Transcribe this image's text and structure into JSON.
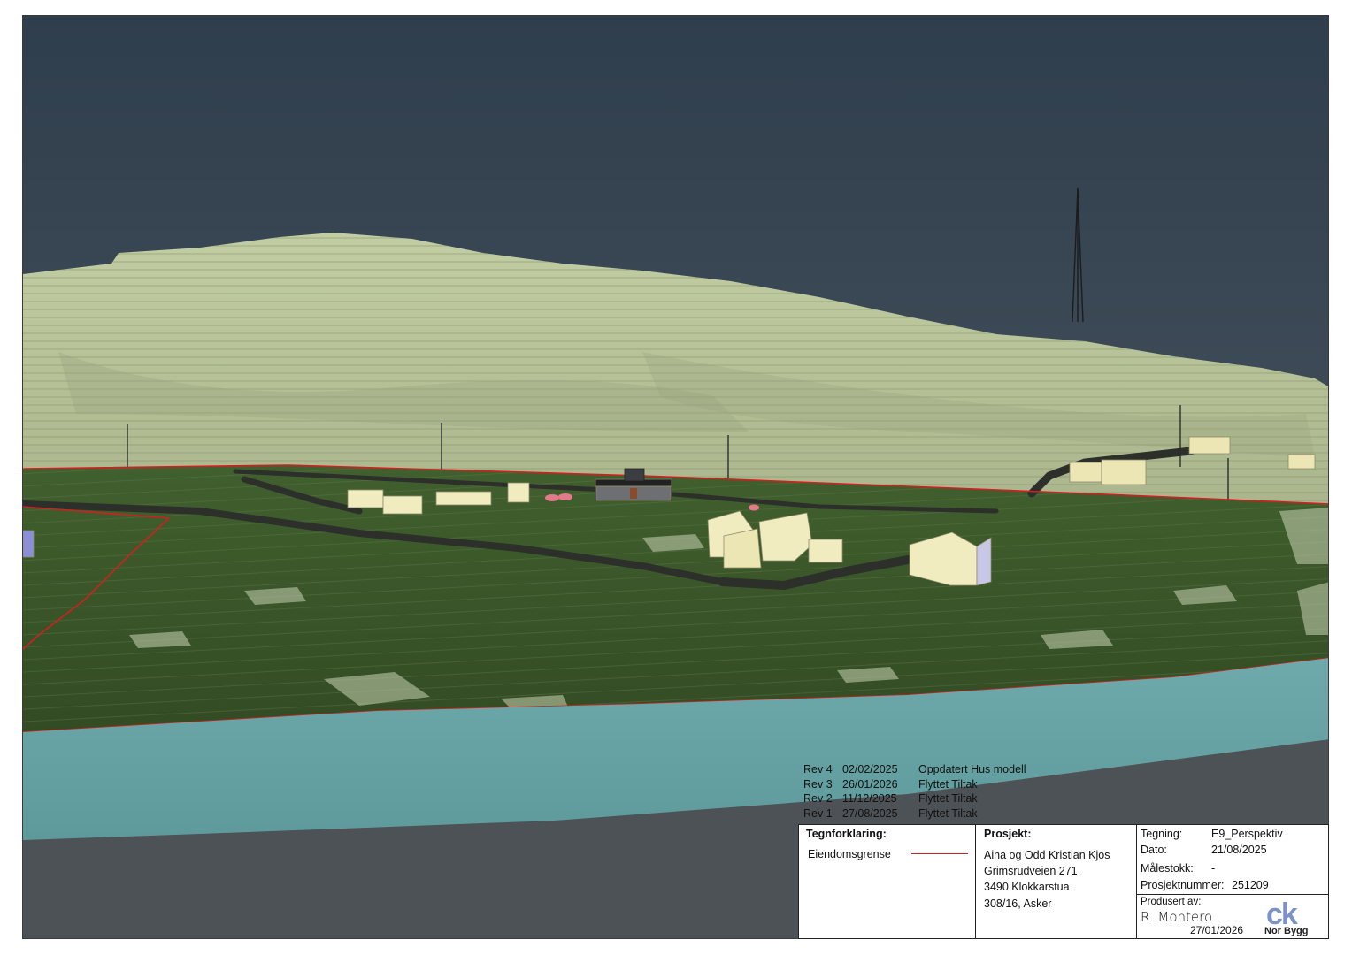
{
  "revisions": [
    {
      "id": "Rev 4",
      "date": "02/02/2025",
      "description": "Oppdatert Hus modell"
    },
    {
      "id": "Rev 3",
      "date": "26/01/2026",
      "description": "Flyttet Tiltak"
    },
    {
      "id": "Rev 2",
      "date": "11/12/2025",
      "description": "Flyttet Tiltak"
    },
    {
      "id": "Rev 1",
      "date": "27/08/2025",
      "description": "Flyttet Tiltak"
    }
  ],
  "legend": {
    "heading": "Tegnforklaring:",
    "items": [
      {
        "label": "Eiendomsgrense",
        "color": "#d02020"
      }
    ]
  },
  "project": {
    "heading": "Prosjekt:",
    "lines": [
      "Aina og Odd Kristian Kjos",
      "Grimsrudveien 271",
      "3490 Klokkarstua",
      "308/16, Asker"
    ]
  },
  "meta": {
    "drawing_label": "Tegning:",
    "drawing_value": "E9_Perspektiv",
    "date_label": "Dato:",
    "date_value": "21/08/2025",
    "scale_label": "Målestokk:",
    "scale_value": "-",
    "project_number_label": "Prosjektnummer:",
    "project_number_value": "251209",
    "produced_by_label": "Produsert av:",
    "produced_by_name": "R. Montero",
    "produced_date": "27/01/2026"
  },
  "logo": {
    "mark": "ck",
    "company": "Nor Bygg"
  },
  "colors": {
    "sky_top": "#2f3e4d",
    "sky_bottom": "#4f5962",
    "hill": "#b9c69a",
    "field": "#3f5a2c",
    "water": "#6aa3a6",
    "property_line": "#d02020",
    "building": "#f0ecc0"
  }
}
